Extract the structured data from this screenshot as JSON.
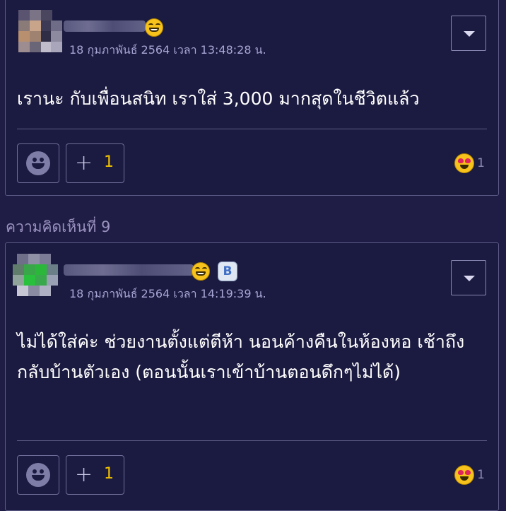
{
  "comments": [
    {
      "timestamp": "18 กุมภาพันธ์ 2564 เวลา 13:48:28 น.",
      "text": "เรานะ กับเพื่อนสนิท เราใส่ 3,000 มากสุดในชีวิตแล้ว",
      "plus_count": "1",
      "emoji_count": "1"
    },
    {
      "label": "ความคิดเห็นที่ 9",
      "timestamp": "18 กุมภาพันธ์ 2564 เวลา 14:19:39 น.",
      "text": "ไม่ได้ใส่ค่ะ ช่วยงานตั้งแต่ตีห้า นอนค้างคืนในห้องหอ เช้าถึงกลับบ้านตัวเอง (ตอนนั้นเราเข้าบ้านตอนดึกๆไม่ได้)",
      "plus_count": "1",
      "emoji_count": "1"
    }
  ],
  "icons": {
    "user_badge_icon": "grin-emoji-icon",
    "blog_badge_icon": "b-badge-icon",
    "menu_icon": "chevron-down-icon",
    "reaction_icon": "smiley-icon",
    "plus_icon": "plus-icon",
    "emoji_count_icon": "heart-eyes-emoji-icon"
  },
  "colors": {
    "background": "#1f1d45",
    "card": "#1b1a40",
    "timestamp": "#a8a7d6",
    "plus_count": "#f2c300",
    "section_label": "#9a92c0"
  }
}
